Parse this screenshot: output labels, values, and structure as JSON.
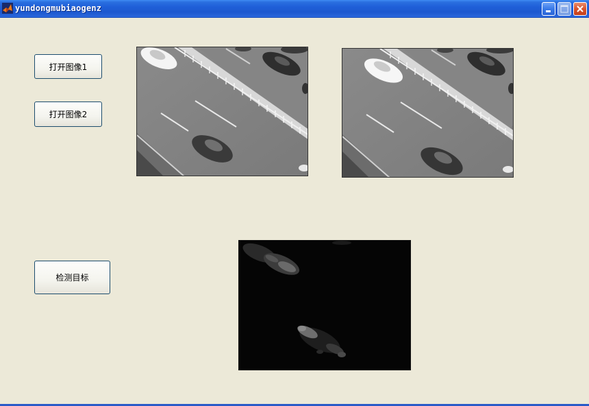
{
  "window": {
    "title": "yundongmubiaogenz"
  },
  "buttons": {
    "open_image_1": "打开图像1",
    "open_image_2": "打开图像2",
    "detect_target": "检测目标"
  },
  "icons": {
    "app": "matlab-logo-icon",
    "minimize": "minimize-icon",
    "maximize": "maximize-icon",
    "close": "close-icon"
  },
  "colors": {
    "window_bg": "#ece9d8",
    "titlebar": "#1f5fd8",
    "close_button": "#d9532b"
  }
}
